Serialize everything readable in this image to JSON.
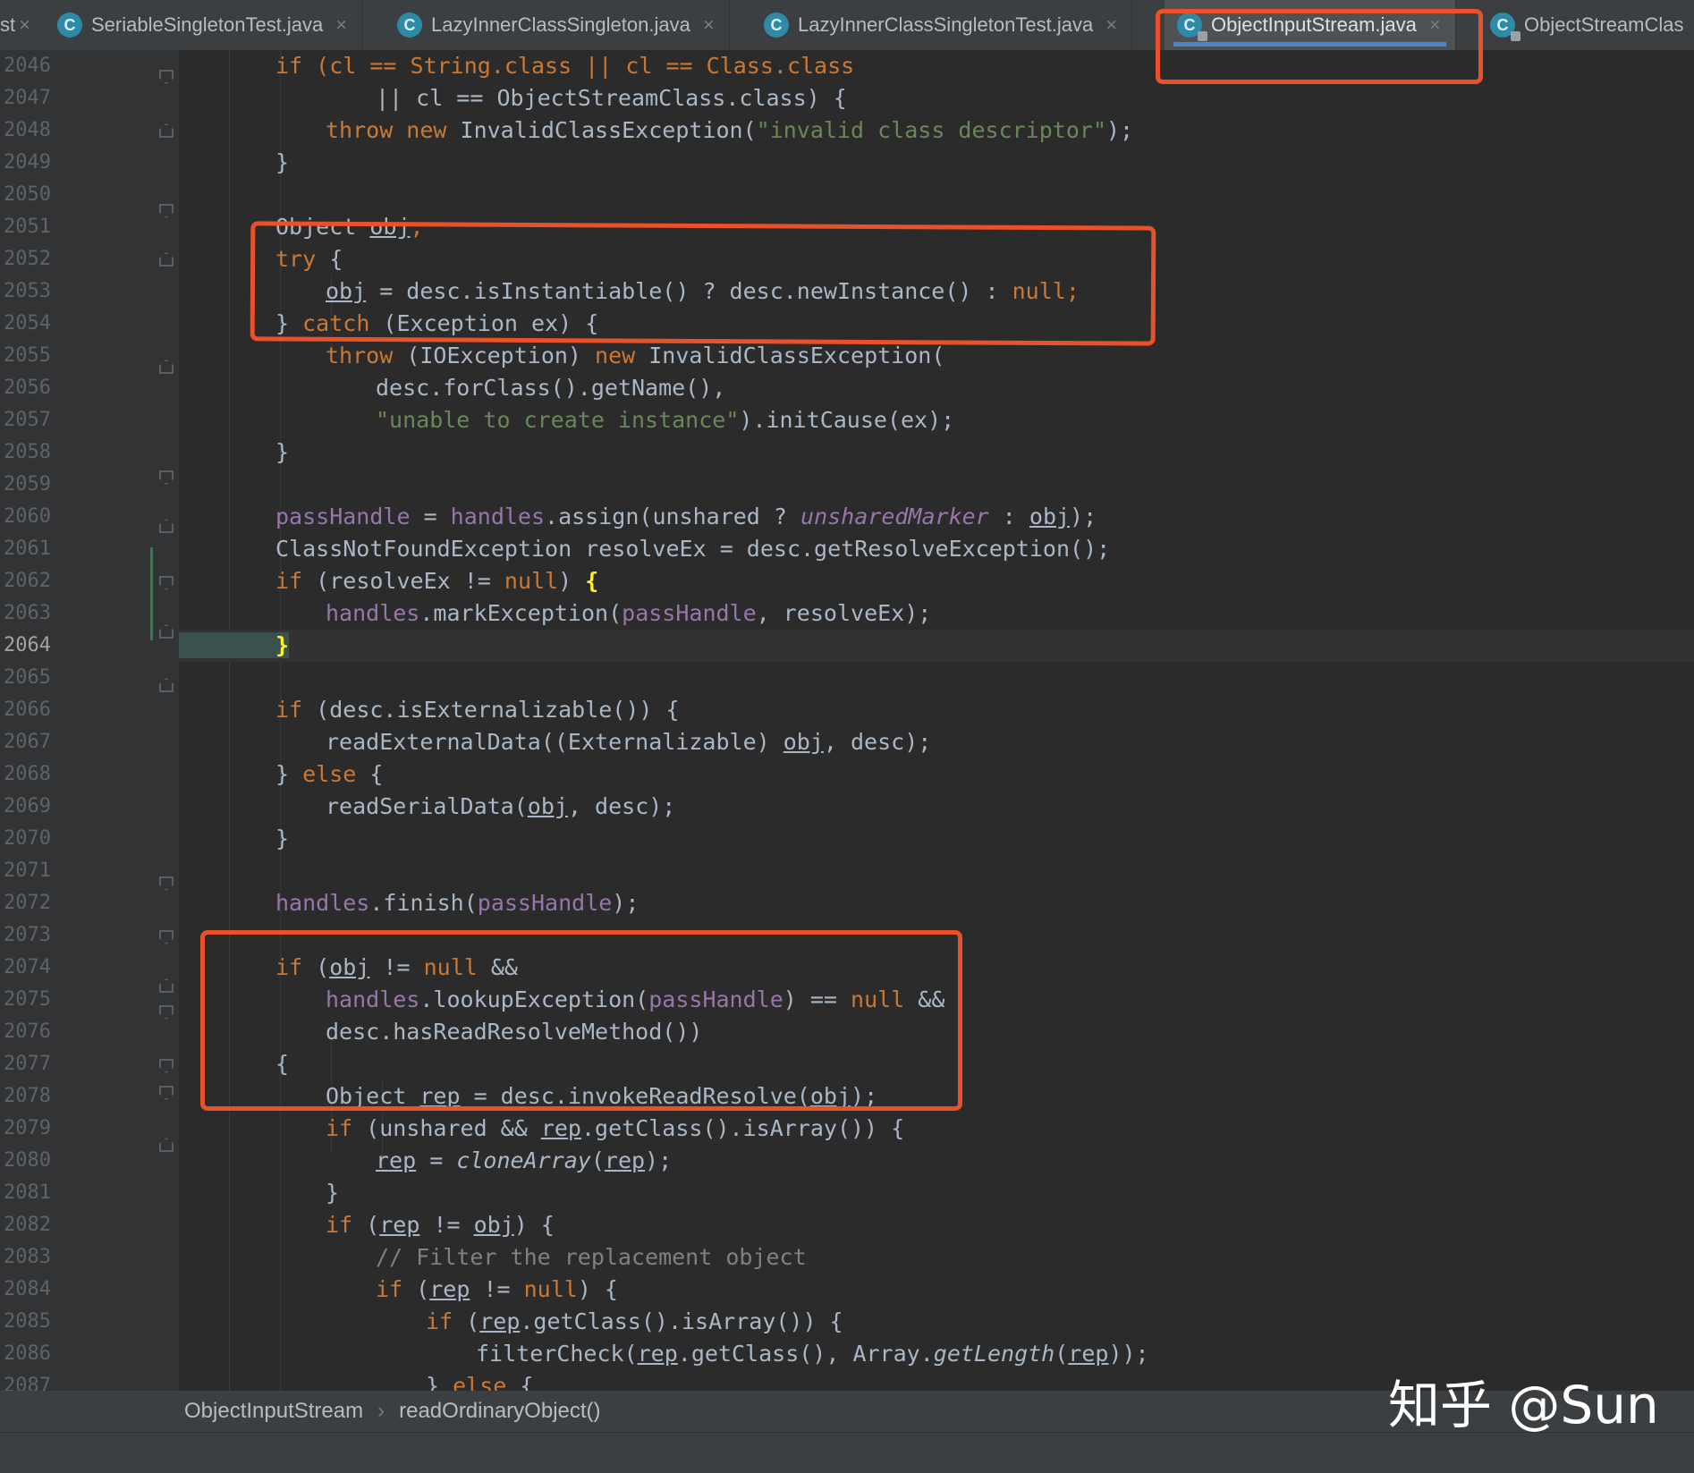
{
  "tabs": [
    {
      "label": "SeriableSingletonTest.java",
      "active": false
    },
    {
      "label": "LazyInnerClassSingleton.java",
      "active": false
    },
    {
      "label": "LazyInnerClassSingletonTest.java",
      "active": false
    },
    {
      "label": "ObjectInputStream.java",
      "active": true
    },
    {
      "label": "ObjectStreamClas",
      "active": false
    }
  ],
  "tab_partial_left": "st",
  "tab_icon_letter": "C",
  "tab_close_glyph": "×",
  "line_numbers": [
    "2046",
    "2047",
    "2048",
    "2049",
    "2050",
    "2051",
    "2052",
    "2053",
    "2054",
    "2055",
    "2056",
    "2057",
    "2058",
    "2059",
    "2060",
    "2061",
    "2062",
    "2063",
    "2064",
    "2065",
    "2066",
    "2067",
    "2068",
    "2069",
    "2070",
    "2071",
    "2072",
    "2073",
    "2074",
    "2075",
    "2076",
    "2077",
    "2078",
    "2079",
    "2080",
    "2081",
    "2082",
    "2083",
    "2084",
    "2085",
    "2086",
    "2087"
  ],
  "current_line": "2064",
  "code": {
    "l2046": "if (cl == String.class || cl == Class.class",
    "l2047": "|| cl == ObjectStreamClass.class) {",
    "l2048_kw": "throw new",
    "l2048_a": " InvalidClassException(",
    "l2048_s": "\"invalid class descriptor\"",
    "l2048_b": ");",
    "l2049": "}",
    "l2051_a": "Object ",
    "l2051_b": "obj",
    "l2051_c": ";",
    "l2052_kw": "try",
    "l2052_b": " {",
    "l2053_a": "obj",
    "l2053_b": " = desc.isInstantiable() ? desc.newInstance() : ",
    "l2053_kw": "null",
    "l2053_c": ";",
    "l2054_a": "} ",
    "l2054_kw": "catch",
    "l2054_b": " (Exception ex) {",
    "l2055_kw": "throw",
    "l2055_a": " (IOException) ",
    "l2055_kw2": "new",
    "l2055_b": " InvalidClassException(",
    "l2056": "desc.forClass().getName(),",
    "l2057_s": "\"unable to create instance\"",
    "l2057_b": ").initCause(ex);",
    "l2058": "}",
    "l2060_f1": "passHandle",
    "l2060_a": " = ",
    "l2060_f2": "handles",
    "l2060_b": ".assign(unshared ? ",
    "l2060_fi": "unsharedMarker",
    "l2060_c": " : ",
    "l2060_d": "obj",
    "l2060_e": ");",
    "l2061": "ClassNotFoundException resolveEx = desc.getResolveException();",
    "l2062_kw": "if",
    "l2062_a": " (resolveEx != ",
    "l2062_kw2": "null",
    "l2062_b": ") ",
    "l2062_c": "{",
    "l2063_f1": "handles",
    "l2063_a": ".markException(",
    "l2063_f2": "passHandle",
    "l2063_b": ", resolveEx);",
    "l2064": "}",
    "l2066_kw": "if",
    "l2066_a": " (desc.isExternalizable()) {",
    "l2067_a": "readExternalData((Externalizable) ",
    "l2067_b": "obj",
    "l2067_c": ", desc);",
    "l2068_a": "} ",
    "l2068_kw": "else",
    "l2068_b": " {",
    "l2069_a": "readSerialData(",
    "l2069_b": "obj",
    "l2069_c": ", desc);",
    "l2070": "}",
    "l2072_f1": "handles",
    "l2072_a": ".finish(",
    "l2072_f2": "passHandle",
    "l2072_b": ");",
    "l2074_kw": "if",
    "l2074_a": " (",
    "l2074_b": "obj",
    "l2074_c": " != ",
    "l2074_kw2": "null",
    "l2074_d": " &&",
    "l2075_f1": "handles",
    "l2075_a": ".lookupException(",
    "l2075_f2": "passHandle",
    "l2075_b": ") == ",
    "l2075_kw": "null",
    "l2075_c": " &&",
    "l2076": "desc.hasReadResolveMethod())",
    "l2077": "{",
    "l2078_a": "Object ",
    "l2078_b": "rep",
    "l2078_c": " = desc.invokeReadResolve(",
    "l2078_d": "obj",
    "l2078_e": ");",
    "l2079_kw": "if",
    "l2079_a": " (unshared && ",
    "l2079_b": "rep",
    "l2079_c": ".getClass().isArray()) {",
    "l2080_a": "rep",
    "l2080_b": " = ",
    "l2080_it": "cloneArray",
    "l2080_c": "(",
    "l2080_d": "rep",
    "l2080_e": ");",
    "l2081": "}",
    "l2082_kw": "if",
    "l2082_a": " (",
    "l2082_b": "rep",
    "l2082_c": " != ",
    "l2082_d": "obj",
    "l2082_e": ") {",
    "l2083": "// Filter the replacement object",
    "l2084_kw": "if",
    "l2084_a": " (",
    "l2084_b": "rep",
    "l2084_c": " != ",
    "l2084_kw2": "null",
    "l2084_d": ") {",
    "l2085_kw": "if",
    "l2085_a": " (",
    "l2085_b": "rep",
    "l2085_c": ".getClass().isArray()) {",
    "l2086_a": "filterCheck(",
    "l2086_b": "rep",
    "l2086_c": ".getClass(), Array.",
    "l2086_it": "getLength",
    "l2086_d": "(",
    "l2086_e": "rep",
    "l2086_f": "));",
    "l2087_a": "} ",
    "l2087_kw": "else",
    "l2087_b": " {"
  },
  "breadcrumb": {
    "class_name": "ObjectInputStream",
    "separator": "›",
    "method": "readOrdinaryObject()"
  },
  "watermark": "知乎 @Sun",
  "colors": {
    "highlight_box": "#e8512a",
    "keyword": "#cc7832",
    "string": "#6a8759",
    "field": "#9876aa",
    "tab_underline": "#4a88c7"
  }
}
